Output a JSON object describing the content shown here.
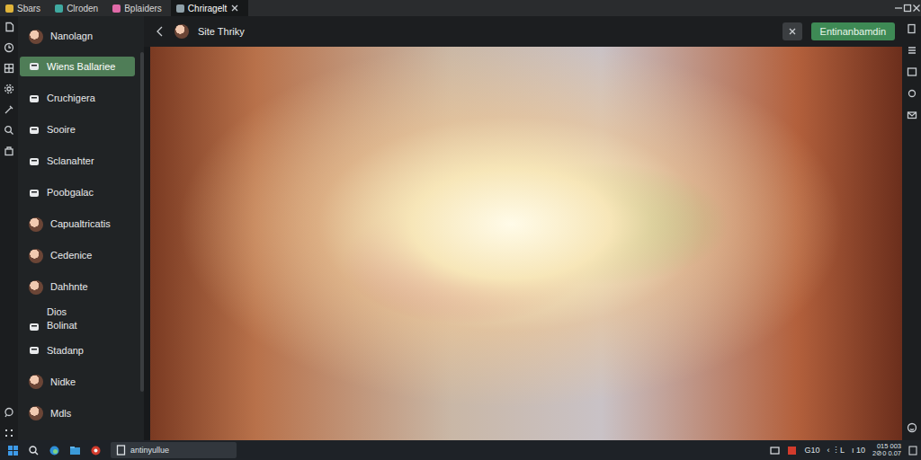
{
  "window": {
    "tabs": [
      {
        "label": "Sbars",
        "selected": false,
        "color": "#e0b43a"
      },
      {
        "label": "Clroden",
        "selected": false,
        "color": "#3fa9a0"
      },
      {
        "label": "Bplaiders",
        "selected": false,
        "color": "#e06aa8"
      },
      {
        "label": "Chriragelt",
        "selected": true,
        "color": "#8fa0a8"
      }
    ]
  },
  "sidebar": {
    "items": [
      {
        "label": "Nanolagn",
        "selected": false,
        "kind": "avatar"
      },
      {
        "label": "Wiens Ballariee",
        "selected": true,
        "kind": "icon"
      },
      {
        "label": "Cruchigera",
        "selected": false,
        "kind": "icon"
      },
      {
        "label": "Sooire",
        "selected": false,
        "kind": "icon"
      },
      {
        "label": "Sclanahter",
        "selected": false,
        "kind": "icon"
      },
      {
        "label": "Poobgalac",
        "selected": false,
        "kind": "icon"
      },
      {
        "label": "Capualtricatis",
        "selected": false,
        "kind": "avatar"
      },
      {
        "label": "Cedenice",
        "selected": false,
        "kind": "avatar"
      },
      {
        "label": "Dahhnte",
        "selected": false,
        "kind": "avatar"
      },
      {
        "label": "Dios\nBolinat",
        "selected": false,
        "kind": "icon"
      },
      {
        "label": "Stadanp",
        "selected": false,
        "kind": "icon"
      },
      {
        "label": "Nidke",
        "selected": false,
        "kind": "avatar"
      },
      {
        "label": "Mdls",
        "selected": false,
        "kind": "avatar"
      }
    ]
  },
  "header": {
    "title": "Site Thriky",
    "action_button": "Entinanbamdin"
  },
  "taskbar": {
    "search_value": "antinyullue",
    "tray": [
      "G10",
      "‹ ⋮L",
      "ı 10"
    ],
    "clock": [
      "015 003",
      "2⊘0 0.07"
    ]
  }
}
